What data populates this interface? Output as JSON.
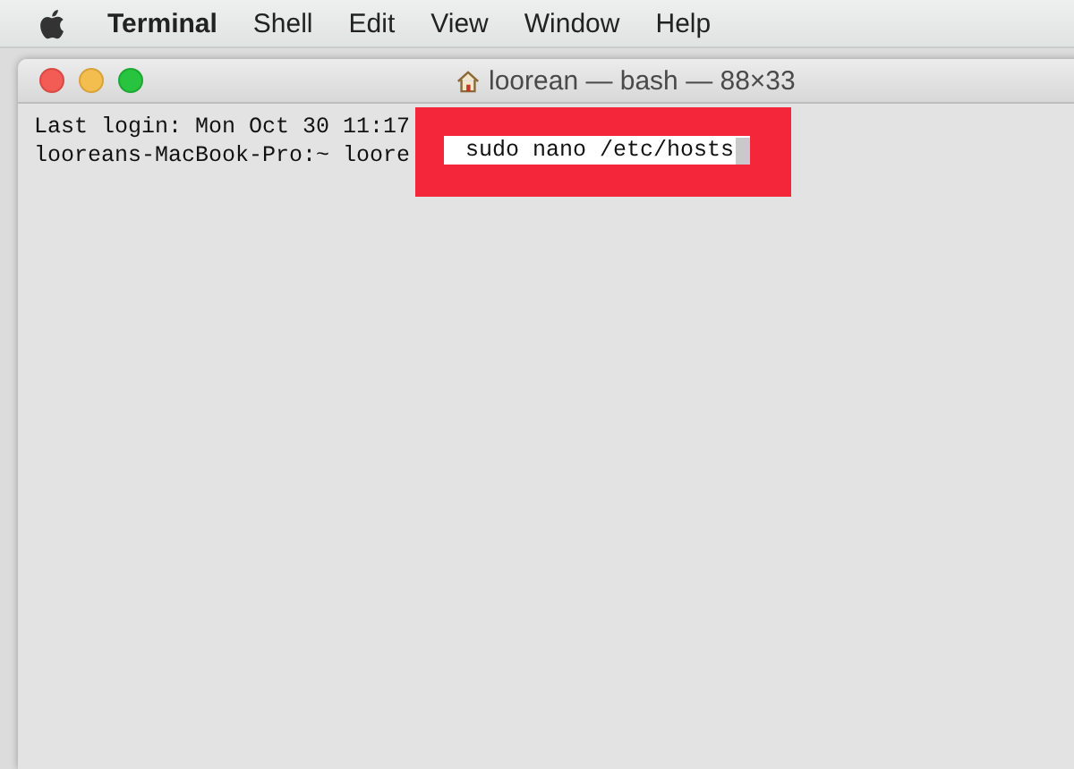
{
  "menu_bar": {
    "items": [
      {
        "label": "Terminal",
        "selected": true
      },
      {
        "label": "Shell",
        "selected": false
      },
      {
        "label": "Edit",
        "selected": false
      },
      {
        "label": "View",
        "selected": false
      },
      {
        "label": "Window",
        "selected": false
      },
      {
        "label": "Help",
        "selected": false
      }
    ]
  },
  "window": {
    "title": "loorean — bash — 88×33"
  },
  "terminal": {
    "lines": [
      "Last login: Mon Oct 30 11:17",
      "looreans-MacBook-Pro:~ loore"
    ]
  },
  "highlight": {
    "command": "sudo nano /etc/hosts"
  }
}
